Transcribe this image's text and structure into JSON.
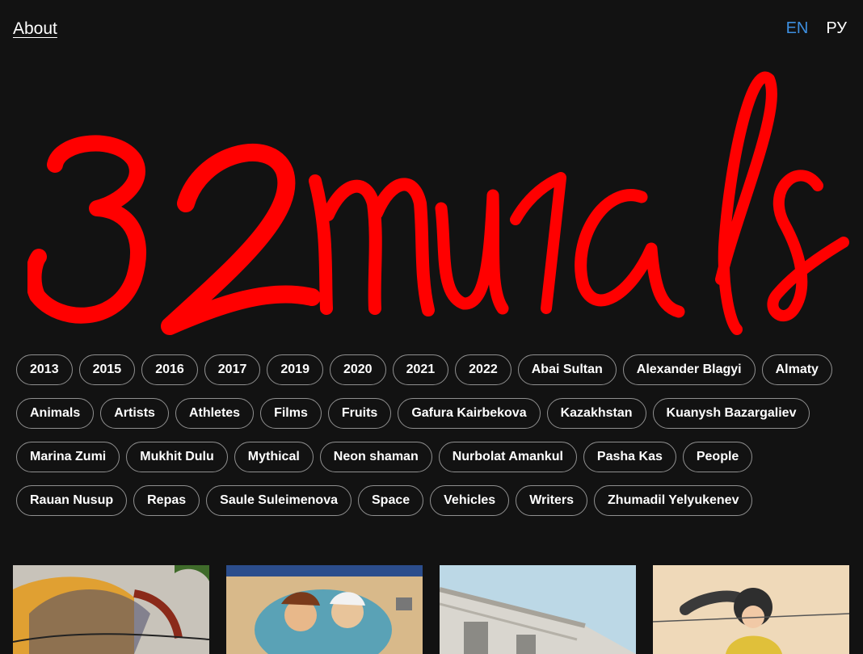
{
  "nav": {
    "about_label": "About"
  },
  "lang": {
    "en": "EN",
    "ru": "РУ"
  },
  "logo": {
    "text": "32murals",
    "color": "#ff0000"
  },
  "tags": [
    "2013",
    "2015",
    "2016",
    "2017",
    "2019",
    "2020",
    "2021",
    "2022",
    "Abai Sultan",
    "Alexander Blagyi",
    "Almaty",
    "Animals",
    "Artists",
    "Athletes",
    "Films",
    "Fruits",
    "Gafura Kairbekova",
    "Kazakhstan",
    "Kuanysh Bazargaliev",
    "Marina Zumi",
    "Mukhit Dulu",
    "Mythical",
    "Neon shaman",
    "Nurbolat Amankul",
    "Pasha Kas",
    "People",
    "Rauan Nusup",
    "Repas",
    "Saule Suleimenova",
    "Space",
    "Vehicles",
    "Writers",
    "Zhumadil Yelyukenev"
  ],
  "colors": {
    "background": "#121212",
    "accent_en": "#3d8fe0",
    "tag_border": "#8f8f8f"
  }
}
